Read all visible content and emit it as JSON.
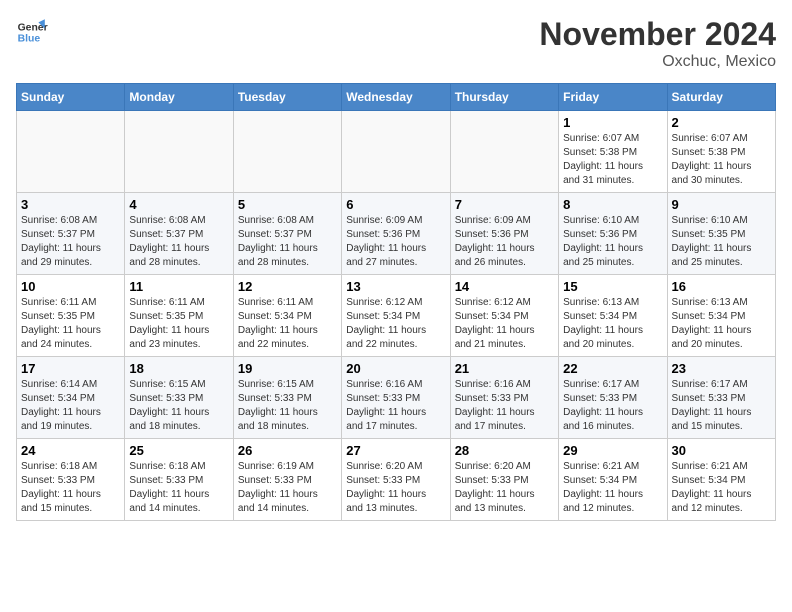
{
  "logo": {
    "line1": "General",
    "line2": "Blue"
  },
  "title": "November 2024",
  "location": "Oxchuc, Mexico",
  "days_header": [
    "Sunday",
    "Monday",
    "Tuesday",
    "Wednesday",
    "Thursday",
    "Friday",
    "Saturday"
  ],
  "weeks": [
    [
      {
        "day": "",
        "info": ""
      },
      {
        "day": "",
        "info": ""
      },
      {
        "day": "",
        "info": ""
      },
      {
        "day": "",
        "info": ""
      },
      {
        "day": "",
        "info": ""
      },
      {
        "day": "1",
        "info": "Sunrise: 6:07 AM\nSunset: 5:38 PM\nDaylight: 11 hours\nand 31 minutes."
      },
      {
        "day": "2",
        "info": "Sunrise: 6:07 AM\nSunset: 5:38 PM\nDaylight: 11 hours\nand 30 minutes."
      }
    ],
    [
      {
        "day": "3",
        "info": "Sunrise: 6:08 AM\nSunset: 5:37 PM\nDaylight: 11 hours\nand 29 minutes."
      },
      {
        "day": "4",
        "info": "Sunrise: 6:08 AM\nSunset: 5:37 PM\nDaylight: 11 hours\nand 28 minutes."
      },
      {
        "day": "5",
        "info": "Sunrise: 6:08 AM\nSunset: 5:37 PM\nDaylight: 11 hours\nand 28 minutes."
      },
      {
        "day": "6",
        "info": "Sunrise: 6:09 AM\nSunset: 5:36 PM\nDaylight: 11 hours\nand 27 minutes."
      },
      {
        "day": "7",
        "info": "Sunrise: 6:09 AM\nSunset: 5:36 PM\nDaylight: 11 hours\nand 26 minutes."
      },
      {
        "day": "8",
        "info": "Sunrise: 6:10 AM\nSunset: 5:36 PM\nDaylight: 11 hours\nand 25 minutes."
      },
      {
        "day": "9",
        "info": "Sunrise: 6:10 AM\nSunset: 5:35 PM\nDaylight: 11 hours\nand 25 minutes."
      }
    ],
    [
      {
        "day": "10",
        "info": "Sunrise: 6:11 AM\nSunset: 5:35 PM\nDaylight: 11 hours\nand 24 minutes."
      },
      {
        "day": "11",
        "info": "Sunrise: 6:11 AM\nSunset: 5:35 PM\nDaylight: 11 hours\nand 23 minutes."
      },
      {
        "day": "12",
        "info": "Sunrise: 6:11 AM\nSunset: 5:34 PM\nDaylight: 11 hours\nand 22 minutes."
      },
      {
        "day": "13",
        "info": "Sunrise: 6:12 AM\nSunset: 5:34 PM\nDaylight: 11 hours\nand 22 minutes."
      },
      {
        "day": "14",
        "info": "Sunrise: 6:12 AM\nSunset: 5:34 PM\nDaylight: 11 hours\nand 21 minutes."
      },
      {
        "day": "15",
        "info": "Sunrise: 6:13 AM\nSunset: 5:34 PM\nDaylight: 11 hours\nand 20 minutes."
      },
      {
        "day": "16",
        "info": "Sunrise: 6:13 AM\nSunset: 5:34 PM\nDaylight: 11 hours\nand 20 minutes."
      }
    ],
    [
      {
        "day": "17",
        "info": "Sunrise: 6:14 AM\nSunset: 5:34 PM\nDaylight: 11 hours\nand 19 minutes."
      },
      {
        "day": "18",
        "info": "Sunrise: 6:15 AM\nSunset: 5:33 PM\nDaylight: 11 hours\nand 18 minutes."
      },
      {
        "day": "19",
        "info": "Sunrise: 6:15 AM\nSunset: 5:33 PM\nDaylight: 11 hours\nand 18 minutes."
      },
      {
        "day": "20",
        "info": "Sunrise: 6:16 AM\nSunset: 5:33 PM\nDaylight: 11 hours\nand 17 minutes."
      },
      {
        "day": "21",
        "info": "Sunrise: 6:16 AM\nSunset: 5:33 PM\nDaylight: 11 hours\nand 17 minutes."
      },
      {
        "day": "22",
        "info": "Sunrise: 6:17 AM\nSunset: 5:33 PM\nDaylight: 11 hours\nand 16 minutes."
      },
      {
        "day": "23",
        "info": "Sunrise: 6:17 AM\nSunset: 5:33 PM\nDaylight: 11 hours\nand 15 minutes."
      }
    ],
    [
      {
        "day": "24",
        "info": "Sunrise: 6:18 AM\nSunset: 5:33 PM\nDaylight: 11 hours\nand 15 minutes."
      },
      {
        "day": "25",
        "info": "Sunrise: 6:18 AM\nSunset: 5:33 PM\nDaylight: 11 hours\nand 14 minutes."
      },
      {
        "day": "26",
        "info": "Sunrise: 6:19 AM\nSunset: 5:33 PM\nDaylight: 11 hours\nand 14 minutes."
      },
      {
        "day": "27",
        "info": "Sunrise: 6:20 AM\nSunset: 5:33 PM\nDaylight: 11 hours\nand 13 minutes."
      },
      {
        "day": "28",
        "info": "Sunrise: 6:20 AM\nSunset: 5:33 PM\nDaylight: 11 hours\nand 13 minutes."
      },
      {
        "day": "29",
        "info": "Sunrise: 6:21 AM\nSunset: 5:34 PM\nDaylight: 11 hours\nand 12 minutes."
      },
      {
        "day": "30",
        "info": "Sunrise: 6:21 AM\nSunset: 5:34 PM\nDaylight: 11 hours\nand 12 minutes."
      }
    ]
  ]
}
